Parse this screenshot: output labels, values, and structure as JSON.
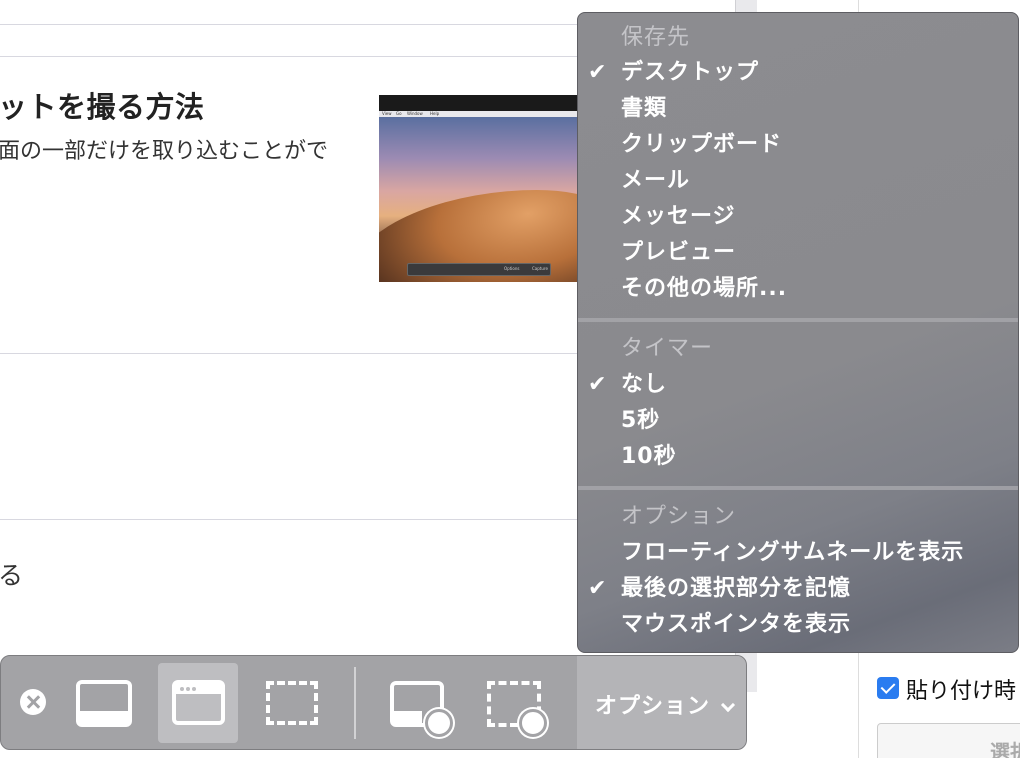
{
  "article": {
    "title": "ットを撮る方法",
    "snippet": "面の一部だけを取り込むことがで",
    "snippet2": "る"
  },
  "thumbnail": {
    "menubar": [
      "View",
      "Go",
      "Window",
      "Help"
    ],
    "bar_options": "Options",
    "bar_capture": "Capture"
  },
  "menu": {
    "save_to": {
      "header": "保存先",
      "items": [
        {
          "label": "デスクトップ",
          "checked": true
        },
        {
          "label": "書類",
          "checked": false
        },
        {
          "label": "クリップボード",
          "checked": false
        },
        {
          "label": "メール",
          "checked": false
        },
        {
          "label": "メッセージ",
          "checked": false
        },
        {
          "label": "プレビュー",
          "checked": false
        },
        {
          "label": "その他の場所...",
          "checked": false
        }
      ]
    },
    "timer": {
      "header": "タイマー",
      "items": [
        {
          "label": "なし",
          "checked": true
        },
        {
          "label": "5秒",
          "checked": false
        },
        {
          "label": "10秒",
          "checked": false
        }
      ]
    },
    "options": {
      "header": "オプション",
      "items": [
        {
          "label": "フローティングサムネールを表示",
          "checked": false
        },
        {
          "label": "最後の選択部分を記憶",
          "checked": true
        },
        {
          "label": "マウスポインタを表示",
          "checked": false
        }
      ]
    },
    "check_glyph": "✔"
  },
  "toolbar": {
    "options_label": "オプション",
    "selected_tool": "capture-selected-window"
  },
  "right_panel": {
    "checkbox_label": "貼り付け時",
    "button_label": "選択"
  },
  "colors": {
    "menu_bg": "#8a8a8e",
    "toolbar_bg": "#a3a3a6",
    "checkbox_blue": "#2a7cf0"
  }
}
